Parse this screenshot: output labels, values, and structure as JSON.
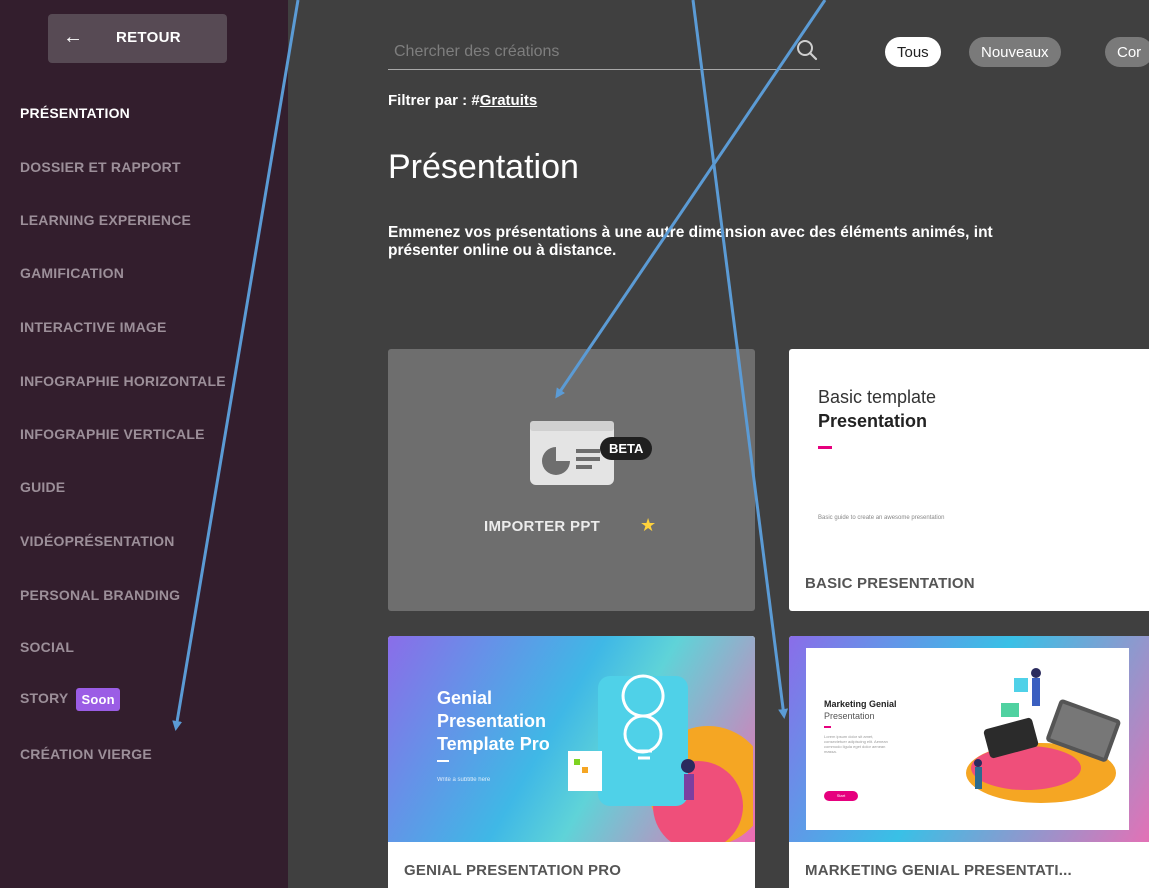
{
  "sidebar": {
    "back_label": "RETOUR",
    "items": [
      {
        "label": "PRÉSENTATION",
        "active": true
      },
      {
        "label": "DOSSIER ET RAPPORT"
      },
      {
        "label": "LEARNING EXPERIENCE"
      },
      {
        "label": "GAMIFICATION"
      },
      {
        "label": "INTERACTIVE IMAGE"
      },
      {
        "label": "INFOGRAPHIE HORIZONTALE"
      },
      {
        "label": "INFOGRAPHIE VERTICALE"
      },
      {
        "label": "GUIDE"
      },
      {
        "label": "VIDÉOPRÉSENTATION"
      },
      {
        "label": "PERSONAL BRANDING"
      },
      {
        "label": "SOCIAL"
      },
      {
        "label": "STORY",
        "badge": "Soon"
      },
      {
        "label": "CRÉATION VIERGE"
      }
    ]
  },
  "search": {
    "placeholder": "Chercher des créations",
    "icon": "search-icon"
  },
  "filters": {
    "chips": [
      {
        "label": "Tous",
        "active": true
      },
      {
        "label": "Nouveaux"
      },
      {
        "label": "Cor"
      }
    ]
  },
  "filter_by": {
    "prefix": "Filtrer par : #",
    "tag": "Gratuits"
  },
  "page": {
    "title": "Présentation",
    "description_line1": "Emmenez vos présentations à une autre dimension avec des éléments animés, int",
    "description_line2": "présenter online ou à distance."
  },
  "cards": {
    "import": {
      "label": "IMPORTER PPT",
      "badge": "BETA",
      "star_icon": "star-icon"
    },
    "basic": {
      "preview_title": "Basic template",
      "preview_subtitle": "Presentation",
      "preview_small": "Basic guide to create an awesome presentation",
      "caption": "BASIC PRESENTATION"
    },
    "genial": {
      "preview_title_1": "Genial",
      "preview_title_2": "Presentation",
      "preview_title_3": "Template Pro",
      "preview_sub": "Write a subtitle here",
      "caption": "GENIAL PRESENTATION PRO"
    },
    "marketing": {
      "preview_title": "Marketing Genial",
      "preview_subtitle": "Presentation",
      "preview_small": "Lorem ipsum dolor sit amet, consectetuer adipiscing elit. Aenean commodo ligula eget dolor aenean massa.",
      "preview_button": "Start",
      "caption": "MARKETING GENIAL PRESENTATI..."
    }
  },
  "colors": {
    "sidebar_bg": "#331e2d",
    "main_bg": "#404040",
    "arrow": "#5b9bd5",
    "accent": "#e6007e",
    "soon_badge": "#9b5de5",
    "star": "#ffd23c"
  }
}
